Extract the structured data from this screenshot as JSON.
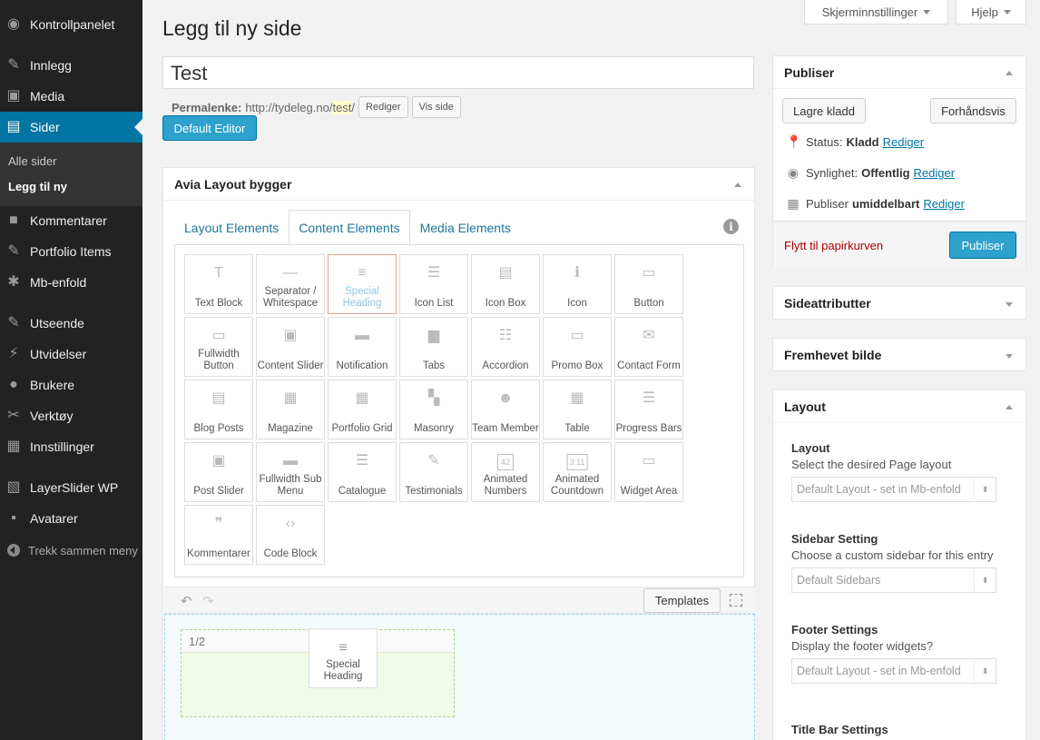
{
  "admin_menu": {
    "items": [
      {
        "label": "Kontrollpanelet",
        "icon": "dashboard-icon"
      },
      {
        "label": "Innlegg",
        "icon": "pin-icon"
      },
      {
        "label": "Media",
        "icon": "media-icon"
      },
      {
        "label": "Sider",
        "icon": "pages-icon"
      },
      {
        "label": "Kommentarer",
        "icon": "comment-icon"
      },
      {
        "label": "Portfolio Items",
        "icon": "pin-icon"
      },
      {
        "label": "Mb-enfold",
        "icon": "gear-icon"
      },
      {
        "label": "Utseende",
        "icon": "brush-icon"
      },
      {
        "label": "Utvidelser",
        "icon": "plugin-icon"
      },
      {
        "label": "Brukere",
        "icon": "user-icon"
      },
      {
        "label": "Verktøy",
        "icon": "wrench-icon"
      },
      {
        "label": "Innstillinger",
        "icon": "settings-icon"
      },
      {
        "label": "LayerSlider WP",
        "icon": "layers-icon"
      },
      {
        "label": "Avatarer",
        "icon": "avatar-icon"
      }
    ],
    "submenu": [
      "Alle sider",
      "Legg til ny"
    ],
    "collapse": "Trekk sammen meny"
  },
  "screen_meta": {
    "options": "Skjerminnstillinger",
    "help": "Hjelp"
  },
  "page_title": "Legg til ny side",
  "post_title": "Test",
  "permalink": {
    "label": "Permalenke:",
    "base": "http://tydeleg.no/",
    "slug": "test",
    "trail": "/",
    "edit": "Rediger",
    "view": "Vis side"
  },
  "default_editor": "Default Editor",
  "builder": {
    "title": "Avia Layout bygger",
    "tabs": [
      "Layout Elements",
      "Content Elements",
      "Media Elements"
    ],
    "active_tab": "Content Elements",
    "elements": [
      {
        "label": "Text Block",
        "icon": "T"
      },
      {
        "label": "Separator / Whitespace",
        "icon": "—"
      },
      {
        "label": "Special Heading",
        "icon": "≡"
      },
      {
        "label": "Icon List",
        "icon": "☰"
      },
      {
        "label": "Icon Box",
        "icon": "▤"
      },
      {
        "label": "Icon",
        "icon": "ℹ"
      },
      {
        "label": "Button",
        "icon": "▭"
      },
      {
        "label": "Fullwidth Button",
        "icon": "▭"
      },
      {
        "label": "Content Slider",
        "icon": "▣"
      },
      {
        "label": "Notification",
        "icon": "▬"
      },
      {
        "label": "Tabs",
        "icon": "▆"
      },
      {
        "label": "Accordion",
        "icon": "☷"
      },
      {
        "label": "Promo Box",
        "icon": "▭"
      },
      {
        "label": "Contact Form",
        "icon": "✉"
      },
      {
        "label": "Blog Posts",
        "icon": "▤"
      },
      {
        "label": "Magazine",
        "icon": "▦"
      },
      {
        "label": "Portfolio Grid",
        "icon": "▦"
      },
      {
        "label": "Masonry",
        "icon": "▚"
      },
      {
        "label": "Team Member",
        "icon": "☻"
      },
      {
        "label": "Table",
        "icon": "▦"
      },
      {
        "label": "Progress Bars",
        "icon": "☰"
      },
      {
        "label": "Post Slider",
        "icon": "▣"
      },
      {
        "label": "Fullwidth Sub Menu",
        "icon": "▬"
      },
      {
        "label": "Catalogue",
        "icon": "☰"
      },
      {
        "label": "Testimonials",
        "icon": "✎"
      },
      {
        "label": "Animated Numbers",
        "icon": "42"
      },
      {
        "label": "Animated Countdown",
        "icon": "3:11"
      },
      {
        "label": "Widget Area",
        "icon": "▭"
      },
      {
        "label": "Kommentarer",
        "icon": "❞"
      },
      {
        "label": "Code Block",
        "icon": "‹›"
      }
    ],
    "selected_element": "Special Heading",
    "templates": "Templates",
    "column_label": "1/2",
    "dragged_element": "Special Heading"
  },
  "publish": {
    "title": "Publiser",
    "save_draft": "Lagre kladd",
    "preview": "Forhåndsvis",
    "status_label": "Status:",
    "status_value": "Kladd",
    "visibility_label": "Synlighet:",
    "visibility_value": "Offentlig",
    "schedule_label": "Publiser",
    "schedule_value": "umiddelbart",
    "edit": "Rediger",
    "trash": "Flytt til papirkurven",
    "publish_button": "Publiser"
  },
  "page_attributes": {
    "title": "Sideattributter"
  },
  "featured_image": {
    "title": "Fremhevet bilde"
  },
  "layout": {
    "title": "Layout",
    "fields": [
      {
        "title": "Layout",
        "desc": "Select the desired Page layout",
        "value": "Default Layout - set in Mb-enfold"
      },
      {
        "title": "Sidebar Setting",
        "desc": "Choose a custom sidebar for this entry",
        "value": "Default Sidebars"
      },
      {
        "title": "Footer Settings",
        "desc": "Display the footer widgets?",
        "value": "Default Layout - set in Mb-enfold"
      },
      {
        "title": "Title Bar Settings"
      }
    ]
  },
  "colors": {
    "accent": "#0074a2",
    "button": "#2ea2cc",
    "menu_bg": "#222222",
    "trash": "#aa0000"
  }
}
